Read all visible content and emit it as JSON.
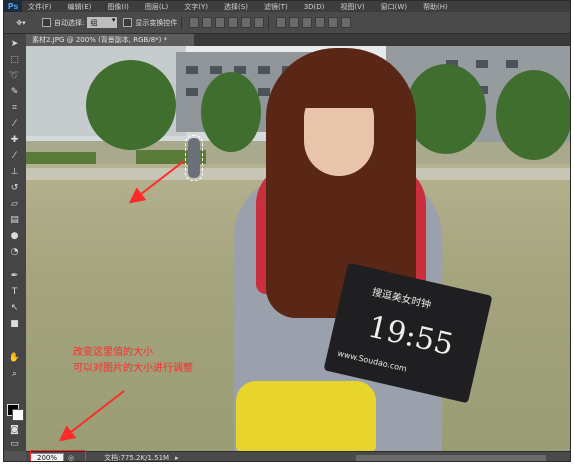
{
  "app": {
    "logo": "Ps"
  },
  "menu": [
    "文件(F)",
    "编辑(E)",
    "图像(I)",
    "图层(L)",
    "文字(Y)",
    "选择(S)",
    "滤镜(T)",
    "3D(D)",
    "视图(V)",
    "窗口(W)",
    "帮助(H)"
  ],
  "options": {
    "auto_select_label": "自动选择:",
    "auto_select_value": "组",
    "show_transform_label": "显示变换控件"
  },
  "document": {
    "tab_title": "素材2.JPG @ 200% (背景副本, RGB/8*) *",
    "board_line1": "搜逗美女时钟",
    "board_time": "19:55",
    "board_sub": "www.Soudao.com"
  },
  "annotation": {
    "line1": "改变这里值的大小",
    "line2": "可以对图片的大小进行调整",
    "color": "#ff2a2a"
  },
  "status": {
    "zoom": "200%",
    "doc_info": "文档:775.2K/1.51M"
  },
  "tools": [
    "move-tool",
    "marquee-tool",
    "lasso-tool",
    "quick-select-tool",
    "crop-tool",
    "eyedropper-tool",
    "healing-brush-tool",
    "brush-tool",
    "clone-stamp-tool",
    "history-brush-tool",
    "eraser-tool",
    "gradient-tool",
    "blur-tool",
    "dodge-tool",
    "pen-tool",
    "type-tool",
    "path-select-tool",
    "shape-tool",
    "hand-tool",
    "zoom-tool"
  ]
}
